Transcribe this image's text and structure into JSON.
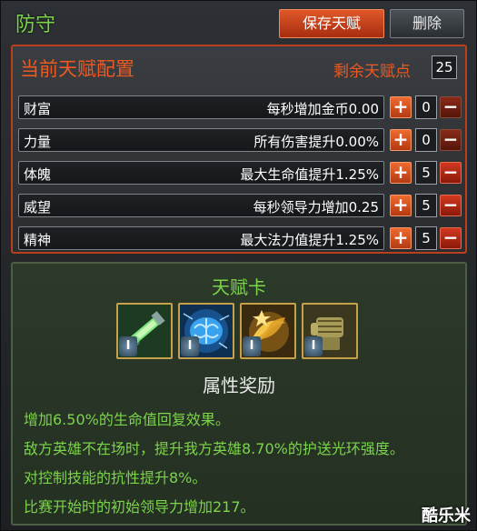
{
  "header": {
    "title": "防守",
    "save_label": "保存天赋",
    "delete_label": "删除"
  },
  "config": {
    "title": "当前天赋配置",
    "points_label": "剩余天赋点",
    "points_value": "25",
    "attributes": [
      {
        "name": "财富",
        "desc": "每秒增加金币0.00",
        "value": "0",
        "minus_active": false
      },
      {
        "name": "力量",
        "desc": "所有伤害提升0.00%",
        "value": "0",
        "minus_active": false
      },
      {
        "name": "体魄",
        "desc": "最大生命值提升1.25%",
        "value": "5",
        "minus_active": true
      },
      {
        "name": "威望",
        "desc": "每秒领导力增加0.25",
        "value": "5",
        "minus_active": true
      },
      {
        "name": "精神",
        "desc": "最大法力值提升1.25%",
        "value": "5",
        "minus_active": true
      }
    ],
    "plus_symbol": "+",
    "minus_symbol": "−"
  },
  "cards": {
    "title": "天赋卡",
    "items": [
      {
        "icon": "syringe-icon",
        "tier": "I"
      },
      {
        "icon": "brain-icon",
        "tier": "I"
      },
      {
        "icon": "swirl-gold-icon",
        "tier": "I"
      },
      {
        "icon": "fist-icon",
        "tier": "I"
      }
    ],
    "bonus_title": "属性奖励",
    "bonuses": [
      "增加6.50%的生命值回复效果。",
      "敌方英雄不在场时，提升我方英雄8.70%的护送光环强度。",
      "对控制技能的抗性提升8%。",
      "比赛开始时的初始领导力增加217。"
    ]
  },
  "watermark": "酷乐米",
  "colors": {
    "accent_green": "#7bd44a",
    "accent_orange": "#ec5a22"
  }
}
